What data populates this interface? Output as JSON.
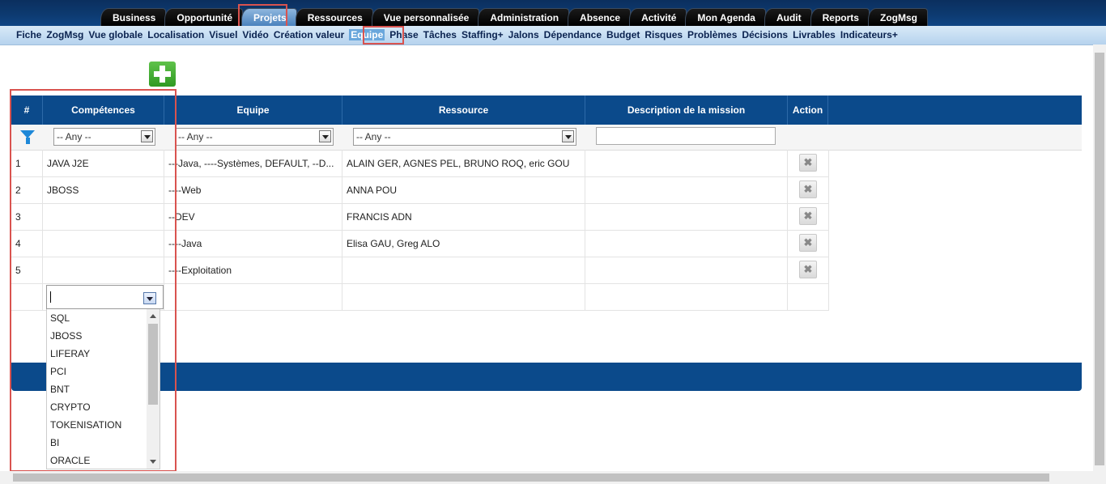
{
  "top_tabs": [
    "Business",
    "Opportunité",
    "Projets",
    "Ressources",
    "Vue personnalisée",
    "Administration",
    "Absence",
    "Activité",
    "Mon Agenda",
    "Audit",
    "Reports",
    "ZogMsg"
  ],
  "active_top_tab": "Projets",
  "sub_nav": [
    "Fiche",
    "ZogMsg",
    "Vue globale",
    "Localisation",
    "Visuel",
    "Vidéo",
    "Création valeur",
    "Equipe",
    "Phase",
    "Tâches",
    "Staffing+",
    "Jalons",
    "Dépendance",
    "Budget",
    "Risques",
    "Problèmes",
    "Décisions",
    "Livrables",
    "Indicateurs+"
  ],
  "active_sub_nav": "Equipe",
  "table": {
    "headers": {
      "num": "#",
      "competences": "Compétences",
      "equipe": "Equipe",
      "ressource": "Ressource",
      "description": "Description de la mission",
      "action": "Action"
    },
    "filters": {
      "competences": "-- Any --",
      "equipe": "-- Any --",
      "ressource": "-- Any --",
      "description": ""
    },
    "rows": [
      {
        "num": "1",
        "competences": "JAVA J2E",
        "equipe": "---Java, ----Systèmes, DEFAULT, --D...",
        "ressource": "ALAIN GER, AGNES PEL, BRUNO ROQ, eric GOU",
        "description": ""
      },
      {
        "num": "2",
        "competences": "JBOSS",
        "equipe": "----Web",
        "ressource": "ANNA POU",
        "description": ""
      },
      {
        "num": "3",
        "competences": "",
        "equipe": "--DEV",
        "ressource": "FRANCIS ADN",
        "description": ""
      },
      {
        "num": "4",
        "competences": "",
        "equipe": "----Java",
        "ressource": "Elisa GAU, Greg ALO",
        "description": ""
      },
      {
        "num": "5",
        "competences": "",
        "equipe": "----Exploitation",
        "ressource": "",
        "description": ""
      }
    ],
    "delete_symbol": "✖"
  },
  "dropdown": {
    "value": "",
    "options": [
      "SQL",
      "JBOSS",
      "LIFERAY",
      "PCI",
      "BNT",
      "CRYPTO",
      "TOKENISATION",
      "BI",
      "ORACLE"
    ]
  },
  "colors": {
    "header_blue": "#0b4a8b",
    "highlight_red": "#d9534f",
    "add_green": "#3aa52b"
  }
}
